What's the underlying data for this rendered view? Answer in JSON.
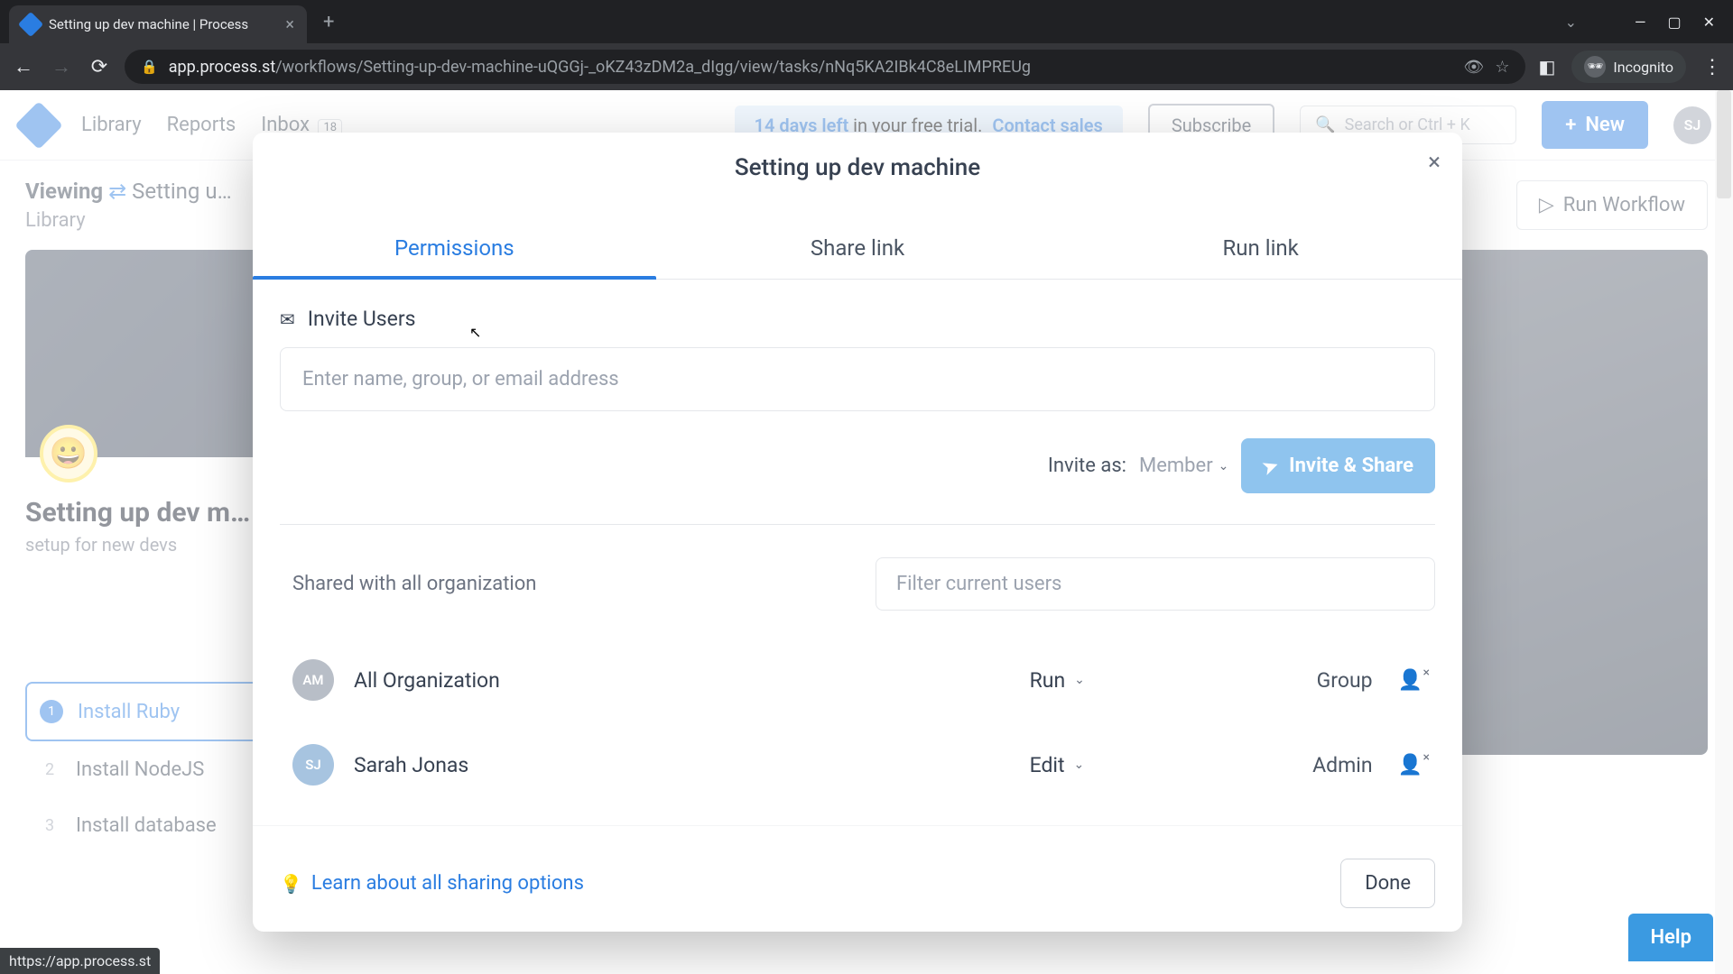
{
  "browser": {
    "tab_title": "Setting up dev machine | Process",
    "url_host": "app.process.st",
    "url_path": "/workflows/Setting-up-dev-machine-uQGGj-_oKZ43zDM2a_dIgg/view/tasks/nNq5KA2IBk4C8eLIMPREUg",
    "incognito_label": "Incognito",
    "status_url": "https://app.process.st"
  },
  "header": {
    "nav": {
      "library": "Library",
      "reports": "Reports",
      "inbox": "Inbox",
      "inbox_count": "18"
    },
    "trial": {
      "days": "14 days left",
      "rest": " in your free trial.",
      "contact": "Contact sales"
    },
    "subscribe": "Subscribe",
    "search_placeholder": "Search or Ctrl + K",
    "new_button": "New",
    "avatar": "SJ"
  },
  "subheader": {
    "viewing": "Viewing",
    "workflow_name": "Setting u…",
    "library": "Library",
    "run_workflow": "Run Workflow"
  },
  "page": {
    "title": "Setting up dev m…",
    "subtitle": "setup for new devs",
    "tasks": [
      {
        "num": "1",
        "label": "Install Ruby"
      },
      {
        "num": "2",
        "label": "Install NodeJS"
      },
      {
        "num": "3",
        "label": "Install database"
      }
    ]
  },
  "modal": {
    "title": "Setting up dev machine",
    "tabs": {
      "permissions": "Permissions",
      "share_link": "Share link",
      "run_link": "Run link"
    },
    "invite_users_label": "Invite Users",
    "invite_placeholder": "Enter name, group, or email address",
    "invite_as_label": "Invite as:",
    "invite_as_value": "Member",
    "invite_share_btn": "Invite & Share",
    "shared_label": "Shared with all organization",
    "filter_placeholder": "Filter current users",
    "users": [
      {
        "initials": "AM",
        "name": "All Organization",
        "permission": "Run",
        "role": "Group"
      },
      {
        "initials": "SJ",
        "name": "Sarah Jonas",
        "permission": "Edit",
        "role": "Admin"
      }
    ],
    "learn_link": "Learn about all sharing options",
    "done": "Done"
  },
  "help_button": "Help"
}
